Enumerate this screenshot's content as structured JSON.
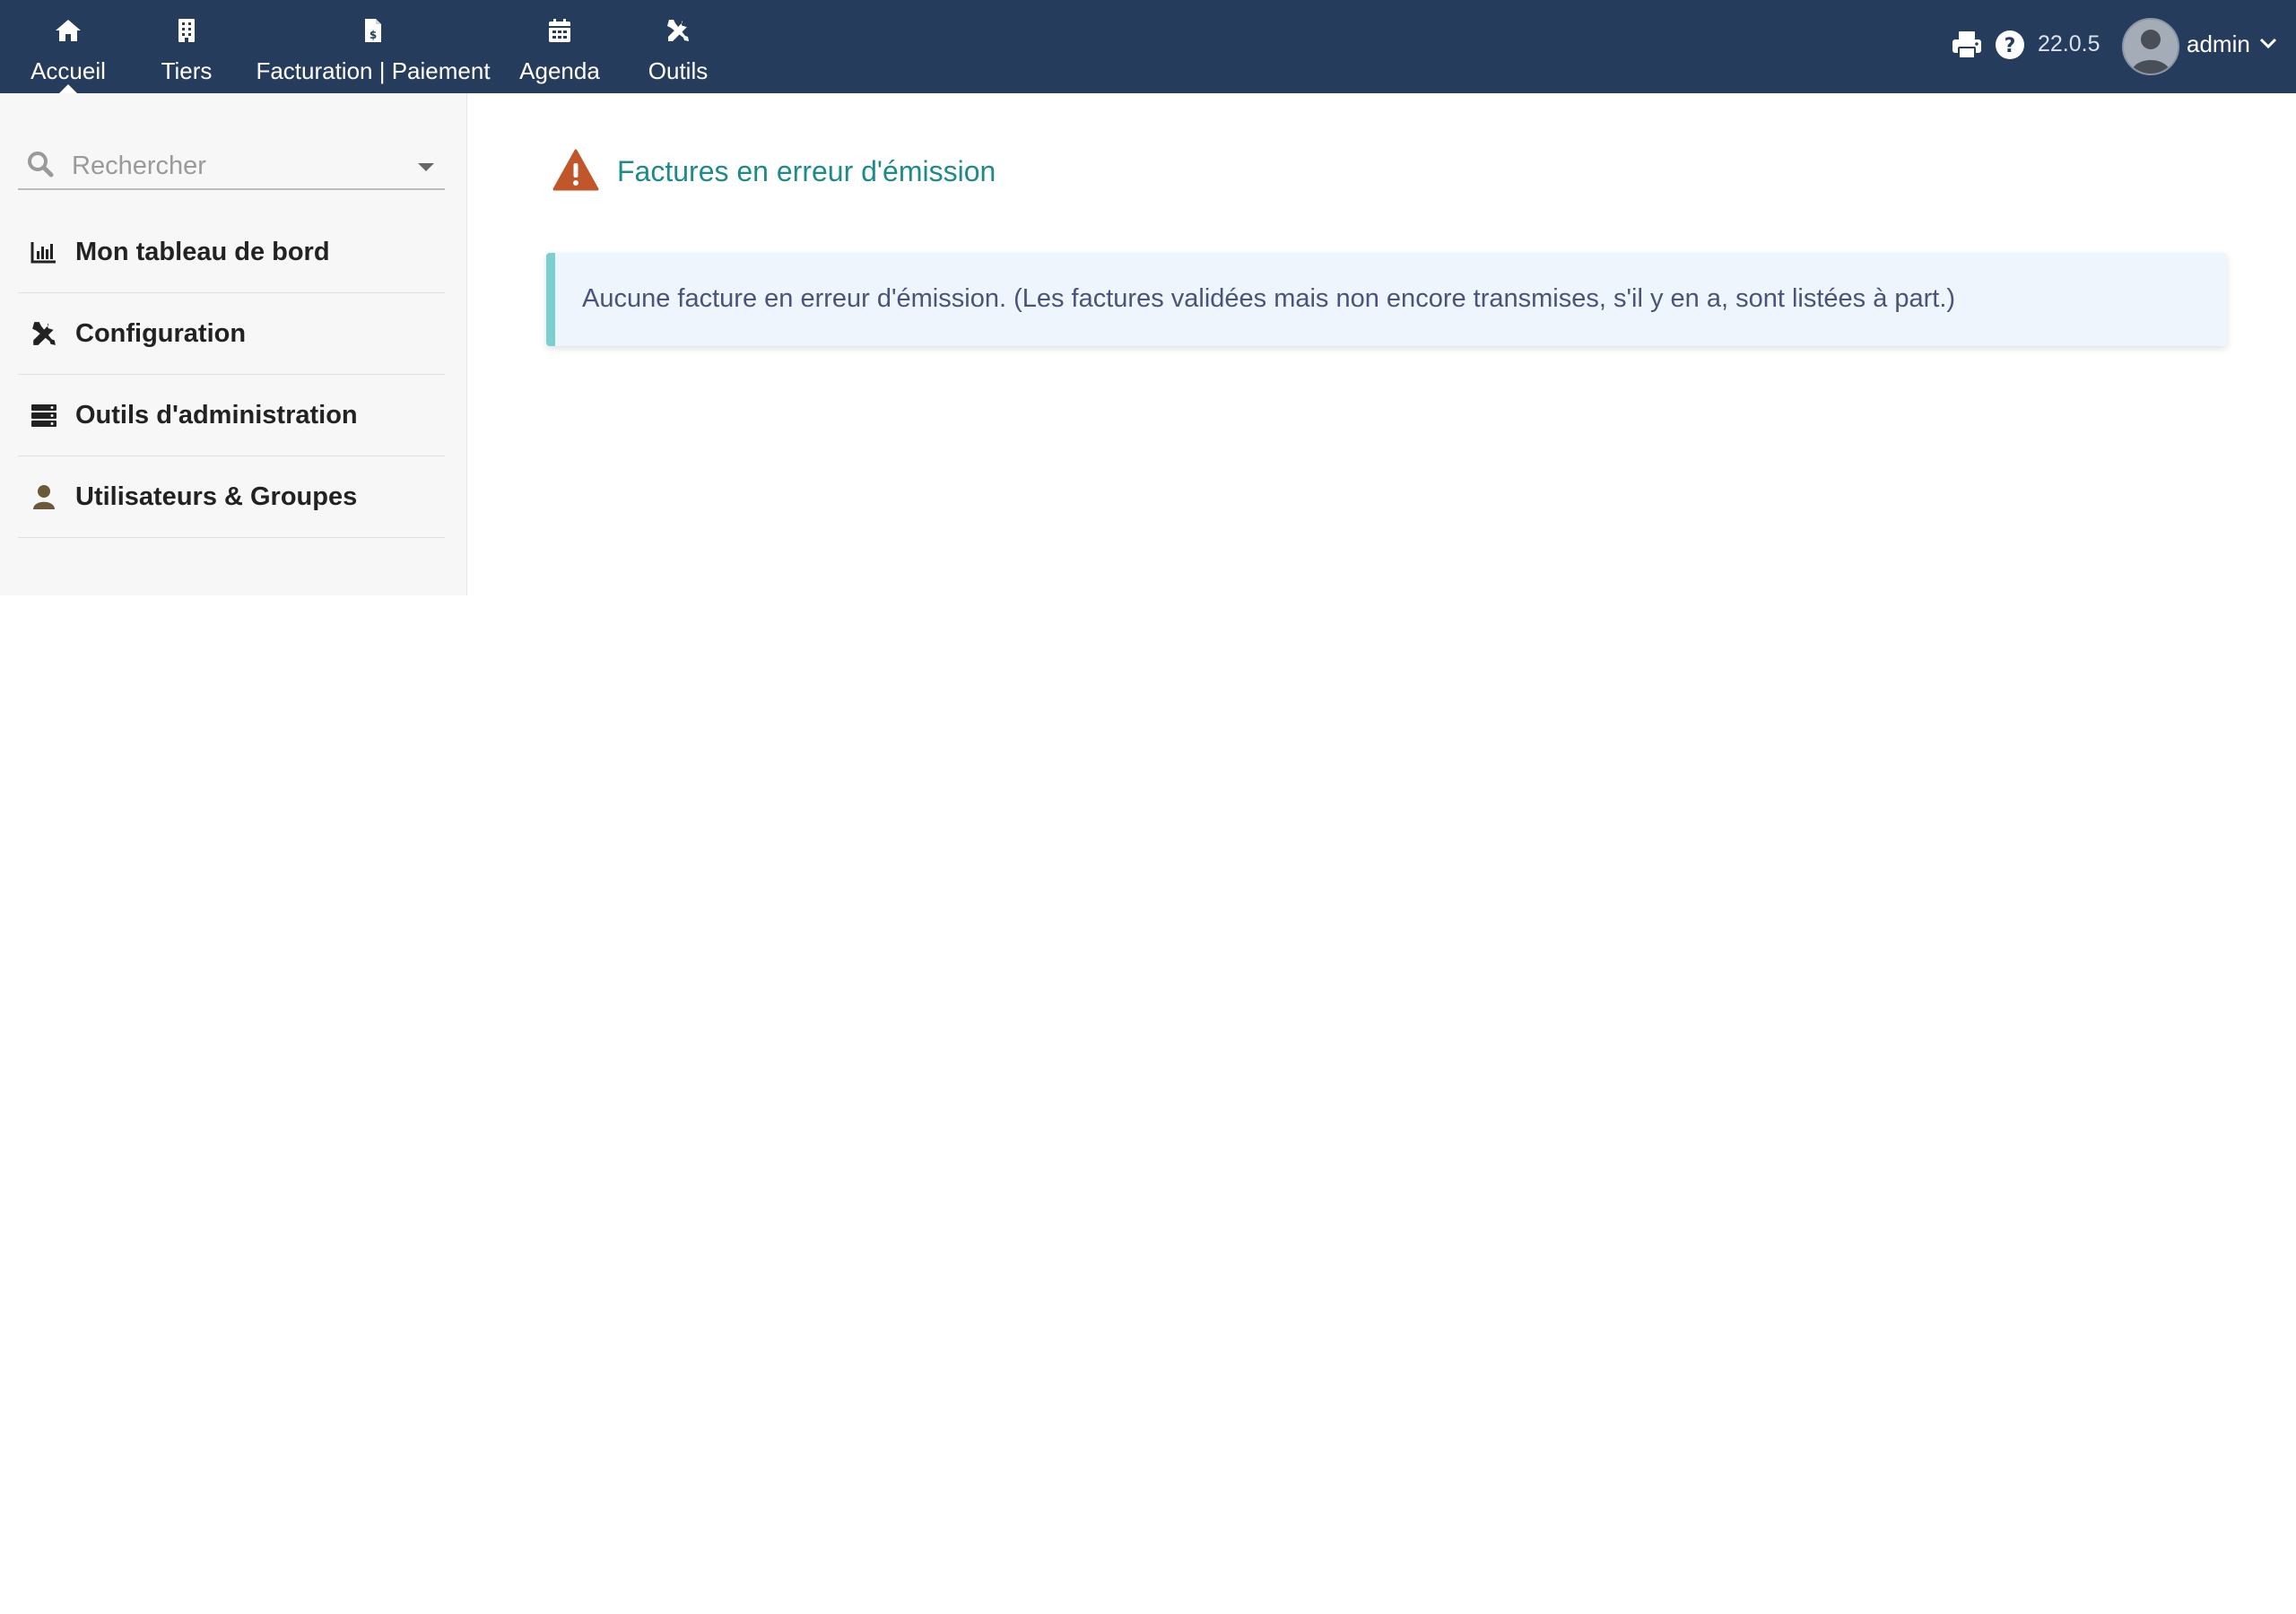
{
  "topnav": {
    "items": [
      {
        "label": "Accueil",
        "icon": "home-icon",
        "active": true
      },
      {
        "label": "Tiers",
        "icon": "building-icon",
        "active": false
      },
      {
        "label": "Facturation | Paiement",
        "icon": "invoice-icon",
        "active": false
      },
      {
        "label": "Agenda",
        "icon": "calendar-icon",
        "active": false
      },
      {
        "label": "Outils",
        "icon": "tools-icon",
        "active": false
      }
    ],
    "version": "22.0.5",
    "username": "admin"
  },
  "sidebar": {
    "search_placeholder": "Rechercher",
    "items": [
      {
        "label": "Mon tableau de bord",
        "icon": "chart-icon"
      },
      {
        "label": "Configuration",
        "icon": "tools-icon"
      },
      {
        "label": "Outils d'administration",
        "icon": "server-icon"
      },
      {
        "label": "Utilisateurs & Groupes",
        "icon": "user-icon"
      }
    ]
  },
  "main": {
    "title": "Factures en erreur d'émission",
    "info_message": "Aucune facture en erreur d'émission. (Les factures validées mais non encore transmises, s'il y en a, sont listées à part.)"
  },
  "colors": {
    "topbar": "#263c5c",
    "title": "#1e8a8a",
    "warning": "#c0562a",
    "info_border": "#7ccfd0",
    "info_bg": "#eef5fd"
  }
}
